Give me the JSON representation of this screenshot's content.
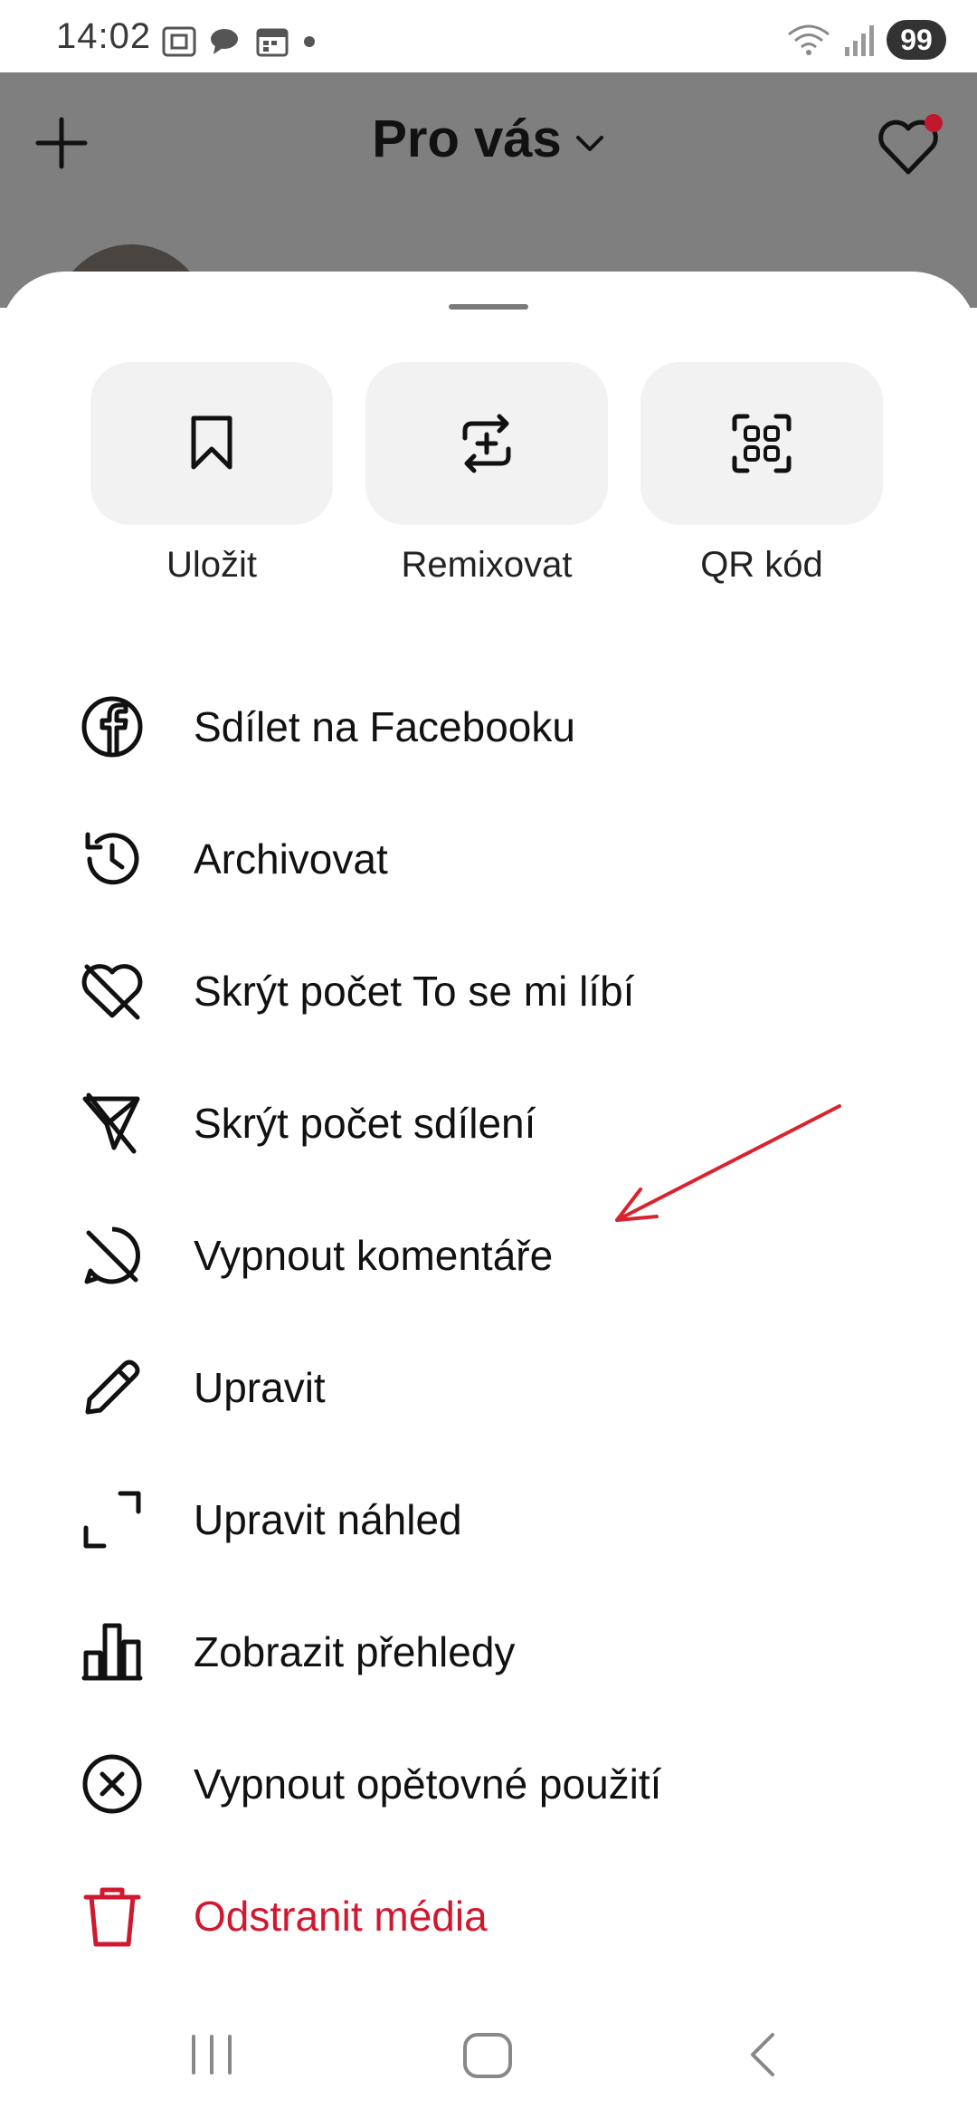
{
  "status_bar": {
    "time": "14:02",
    "battery": "99"
  },
  "app_header": {
    "title": "Pro vás"
  },
  "quick_actions": [
    {
      "label": "Uložit",
      "icon": "bookmark-icon"
    },
    {
      "label": "Remixovat",
      "icon": "remix-icon"
    },
    {
      "label": "QR kód",
      "icon": "qr-code-icon"
    }
  ],
  "menu": [
    {
      "label": "Sdílet na Facebooku",
      "icon": "facebook-icon"
    },
    {
      "label": "Archivovat",
      "icon": "archive-history-icon"
    },
    {
      "label": "Skrýt počet To se mi líbí",
      "icon": "heart-off-icon"
    },
    {
      "label": "Skrýt počet sdílení",
      "icon": "share-off-icon"
    },
    {
      "label": "Vypnout komentáře",
      "icon": "comments-off-icon"
    },
    {
      "label": "Upravit",
      "icon": "pencil-icon"
    },
    {
      "label": "Upravit náhled",
      "icon": "crop-icon"
    },
    {
      "label": "Zobrazit přehledy",
      "icon": "insights-icon"
    },
    {
      "label": "Vypnout opětovné použití",
      "icon": "close-circle-icon"
    },
    {
      "label": "Odstranit média",
      "icon": "trash-icon",
      "color": "#d0182f"
    }
  ],
  "colors": {
    "danger": "#d0182f",
    "annotation": "#d9232e",
    "tile_bg": "#f2f2f2"
  }
}
